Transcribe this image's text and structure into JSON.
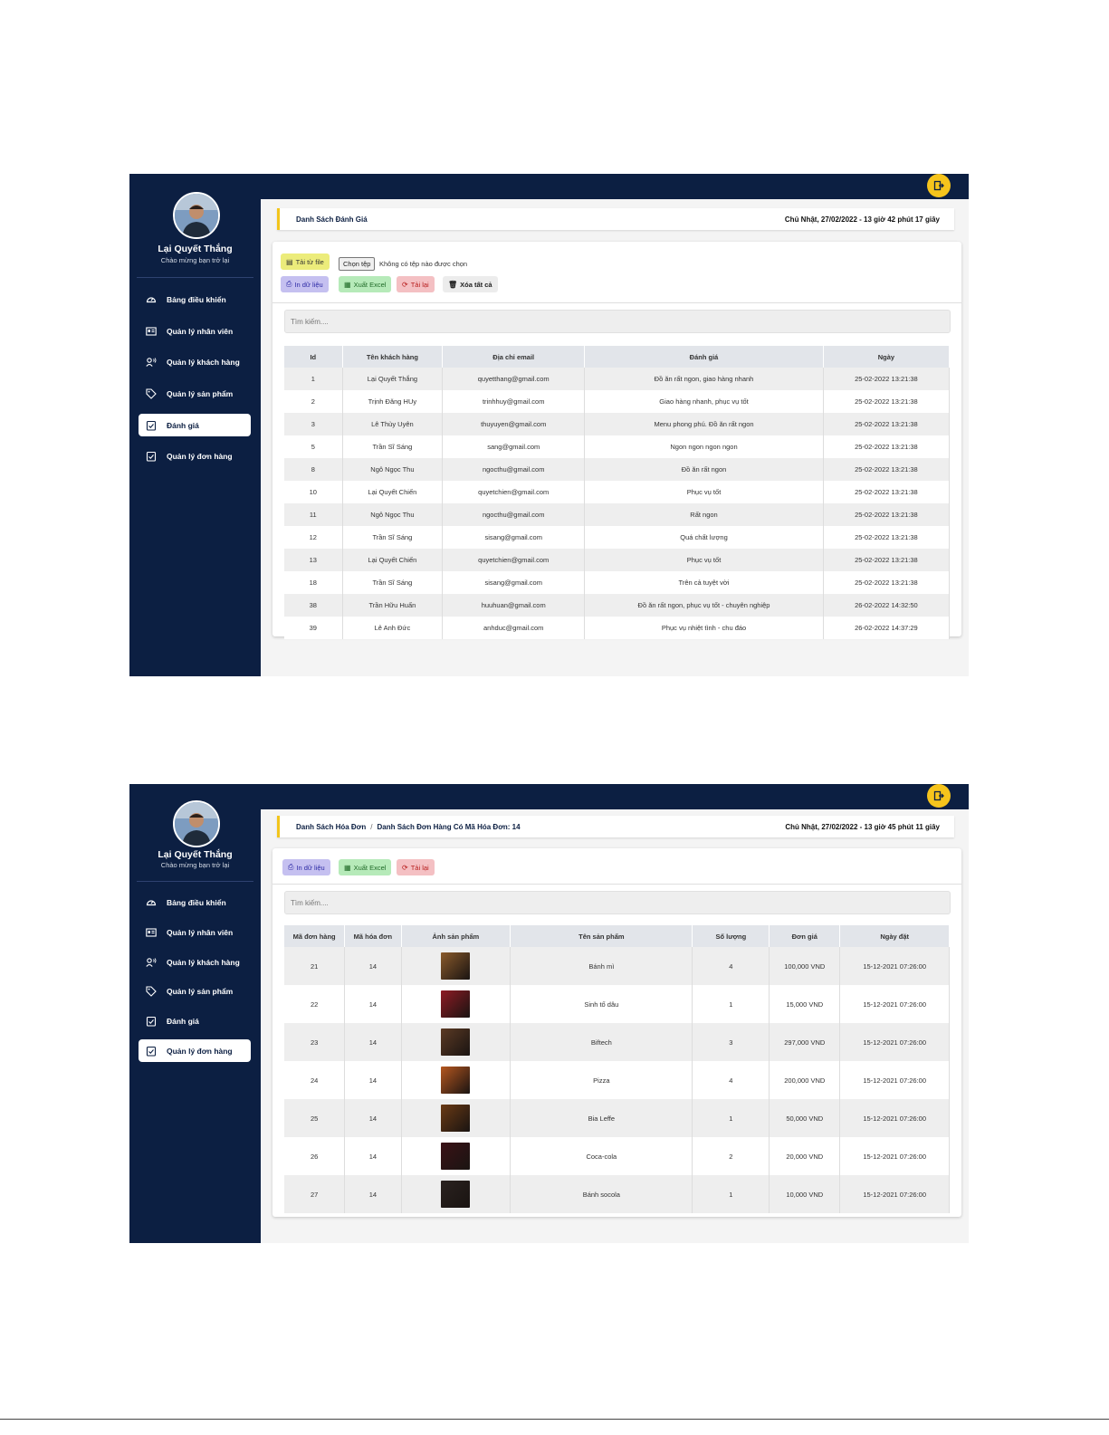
{
  "user": {
    "name": "Lại Quyết Thắng",
    "greeting": "Chào mừng bạn trở lại"
  },
  "nav": [
    {
      "label": "Bảng điều khiển",
      "icon": "gauge-icon"
    },
    {
      "label": "Quản lý nhân viên",
      "icon": "id-card-icon"
    },
    {
      "label": "Quản lý khách hàng",
      "icon": "user-voice-icon"
    },
    {
      "label": "Quản lý sản phẩm",
      "icon": "tag-icon"
    },
    {
      "label": "Đánh giá",
      "icon": "clipboard-check-icon"
    },
    {
      "label": "Quản lý đơn hàng",
      "icon": "clipboard-check-icon"
    }
  ],
  "colors": {
    "sidebar": "#0c1f42",
    "accent": "#f6c41c"
  },
  "screen1": {
    "active_nav": 4,
    "breadcrumb": "Danh Sách Đánh Giá",
    "datetime": "Chủ Nhật, 27/02/2022 - 13 giờ 42 phút 17 giây",
    "buttons": {
      "upload": "Tải từ file",
      "choose_file": "Chọn tệp",
      "no_file": "Không có tệp nào được chọn",
      "print": "In dữ liệu",
      "excel": "Xuất Excel",
      "reload": "Tải lại",
      "delete_all": "Xóa tất cả"
    },
    "search_placeholder": "Tìm kiếm....",
    "columns": [
      "Id",
      "Tên khách hàng",
      "Địa chỉ email",
      "Đánh giá",
      "Ngày"
    ],
    "rows": [
      [
        "1",
        "Lại Quyết Thắng",
        "quyetthang@gmail.com",
        "Đồ ăn rất ngon, giao hàng nhanh",
        "25-02-2022 13:21:38"
      ],
      [
        "2",
        "Trịnh Đăng HUy",
        "trinhhuy@gmail.com",
        "Giao hàng nhanh, phục vụ tốt",
        "25-02-2022 13:21:38"
      ],
      [
        "3",
        "Lê Thùy Uyên",
        "thuyuyen@gmail.com",
        "Menu phong phú. Đồ ăn rất ngon",
        "25-02-2022 13:21:38"
      ],
      [
        "5",
        "Trần Sĩ Sáng",
        "sang@gmail.com",
        "Ngon ngon ngon ngon",
        "25-02-2022 13:21:38"
      ],
      [
        "8",
        "Ngô Ngọc Thu",
        "ngocthu@gmail.com",
        "Đồ ăn rất ngon",
        "25-02-2022 13:21:38"
      ],
      [
        "10",
        "Lại Quyết Chiến",
        "quyetchien@gmail.com",
        "Phục vụ tốt",
        "25-02-2022 13:21:38"
      ],
      [
        "11",
        "Ngô Ngọc Thu",
        "ngocthu@gmail.com",
        "Rất ngon",
        "25-02-2022 13:21:38"
      ],
      [
        "12",
        "Trần Sĩ Sáng",
        "sisang@gmail.com",
        "Quá chất lượng",
        "25-02-2022 13:21:38"
      ],
      [
        "13",
        "Lại Quyết Chiến",
        "quyetchien@gmail.com",
        "Phục vụ tốt",
        "25-02-2022 13:21:38"
      ],
      [
        "18",
        "Trần Sĩ Sáng",
        "sisang@gmail.com",
        "Trên cả tuyệt vời",
        "25-02-2022 13:21:38"
      ],
      [
        "38",
        "Trần Hữu Huấn",
        "huuhuan@gmail.com",
        "Đồ ăn rất ngon, phục vụ tốt - chuyên nghiệp",
        "26-02-2022 14:32:50"
      ],
      [
        "39",
        "Lê Anh Đức",
        "anhduc@gmail.com",
        "Phục vụ nhiệt tình - chu đáo",
        "26-02-2022 14:37:29"
      ]
    ]
  },
  "screen2": {
    "active_nav": 5,
    "breadcrumb_parent": "Danh Sách Hóa Đơn",
    "breadcrumb_separator": "/",
    "breadcrumb_current": "Danh Sách Đơn Hàng Có Mã Hóa Đơn: 14",
    "datetime": "Chủ Nhật, 27/02/2022 - 13 giờ 45 phút 11 giây",
    "buttons": {
      "print": "In dữ liệu",
      "excel": "Xuất Excel",
      "reload": "Tải lại"
    },
    "search_placeholder": "Tìm kiếm....",
    "columns": [
      "Mã đơn hàng",
      "Mã hóa đơn",
      "Ảnh sản phẩm",
      "Tên sản phẩm",
      "Số lượng",
      "Đơn giá",
      "Ngày đặt"
    ],
    "rows": [
      {
        "id": "21",
        "invoice": "14",
        "image": "banh-mi-photo",
        "img_color": "#8a5a2b",
        "name": "Bánh mì",
        "qty": "4",
        "price": "100,000 VND",
        "date": "15-12-2021 07:26:00"
      },
      {
        "id": "22",
        "invoice": "14",
        "image": "sinh-to-dau-photo",
        "img_color": "#8e1b24",
        "name": "Sinh tố dâu",
        "qty": "1",
        "price": "15,000 VND",
        "date": "15-12-2021 07:26:00"
      },
      {
        "id": "23",
        "invoice": "14",
        "image": "biftech-photo",
        "img_color": "#5b3a24",
        "name": "Biftech",
        "qty": "3",
        "price": "297,000 VND",
        "date": "15-12-2021 07:26:00"
      },
      {
        "id": "24",
        "invoice": "14",
        "image": "pizza-photo",
        "img_color": "#b5561f",
        "name": "Pizza",
        "qty": "4",
        "price": "200,000 VND",
        "date": "15-12-2021 07:26:00"
      },
      {
        "id": "25",
        "invoice": "14",
        "image": "bia-leffe-photo",
        "img_color": "#6a3a14",
        "name": "Bia Leffe",
        "qty": "1",
        "price": "50,000 VND",
        "date": "15-12-2021 07:26:00"
      },
      {
        "id": "26",
        "invoice": "14",
        "image": "coca-cola-photo",
        "img_color": "#3a1216",
        "name": "Coca-cola",
        "qty": "2",
        "price": "20,000 VND",
        "date": "15-12-2021 07:26:00"
      },
      {
        "id": "27",
        "invoice": "14",
        "image": "banh-socola-photo",
        "img_color": "#2a221f",
        "name": "Bánh socola",
        "qty": "1",
        "price": "10,000 VND",
        "date": "15-12-2021 07:26:00"
      }
    ]
  }
}
